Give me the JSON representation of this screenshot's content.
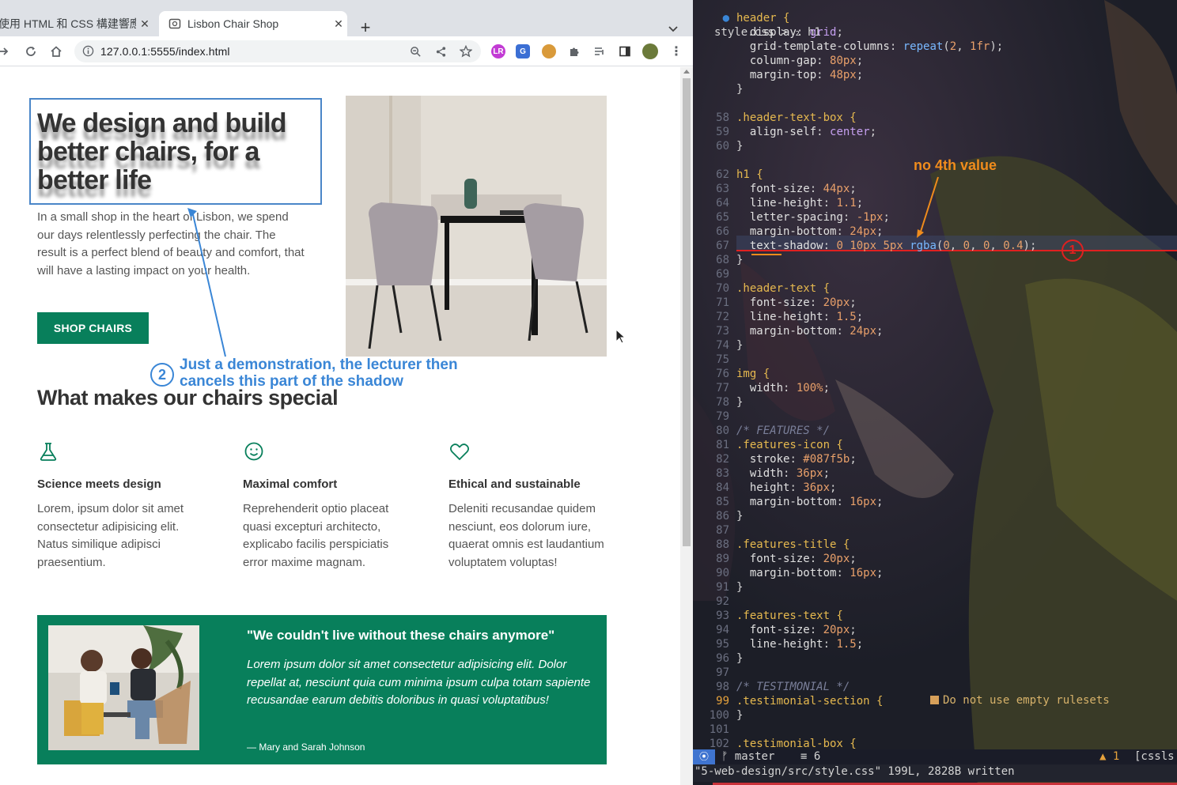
{
  "browser": {
    "tabs": [
      {
        "label": "使用 HTML 和 CSS 構建響應",
        "active": false
      },
      {
        "label": "Lisbon Chair Shop",
        "active": true
      }
    ],
    "url": "127.0.0.1:5555/index.html",
    "new_tab_glyph": "+",
    "close_glyph": "✕",
    "extensions": [
      "lr-icon",
      "translate-icon",
      "cookie-icon",
      "puzzle-icon",
      "playlist-icon",
      "sidepanel-icon",
      "profile-avatar"
    ]
  },
  "page": {
    "h1": "We design and build better chairs, for a better life",
    "header_text": "In a small shop in the heart of Lisbon, we spend our days relentlessly perfecting the chair. The result is a perfect blend of beauty and comfort, that will have a lasting impact on your health.",
    "cta": "SHOP CHAIRS",
    "features_heading": "What makes our chairs special",
    "features": [
      {
        "icon": "flask-icon",
        "title": "Science meets design",
        "text": "Lorem, ipsum dolor sit amet consectetur adipisicing elit. Natus similique adipisci praesentium."
      },
      {
        "icon": "smiley-icon",
        "title": "Maximal comfort",
        "text": "Reprehenderit optio placeat quasi excepturi architecto, explicabo facilis perspiciatis error maxime magnam."
      },
      {
        "icon": "heart-icon",
        "title": "Ethical and sustainable",
        "text": "Deleniti recusandae quidem nesciunt, eos dolorum iure, quaerat omnis est laudantium voluptatem voluptas!"
      }
    ],
    "testimonial": {
      "quote": "\"We couldn't live without these chairs anymore\"",
      "text": "Lorem ipsum dolor sit amet consectetur adipisicing elit. Dolor repellat at, nesciunt quia cum minima ipsum culpa totam sapiente recusandae earum debitis doloribus in quasi voluptatibus!",
      "author": "— Mary and Sarah Johnson"
    },
    "accent_color": "#087f5b"
  },
  "annotations": {
    "a1_num": "1",
    "a2_num": "2",
    "a2_text_line1": "Just a demonstration, the lecturer then",
    "a2_text_line2": "cancels this part of the shadow",
    "no4th": "no 4th value"
  },
  "editor": {
    "breadcrumb": "style.css > ₂ h1",
    "lines": [
      {
        "n": "",
        "code": "header {"
      },
      {
        "n": "",
        "code": "  display: grid;"
      },
      {
        "n": "",
        "code": "  grid-template-columns: repeat(2, 1fr);"
      },
      {
        "n": "",
        "code": "  column-gap: 80px;"
      },
      {
        "n": "",
        "code": "  margin-top: 48px;"
      },
      {
        "n": "",
        "code": "}"
      },
      {
        "n": "",
        "code": ""
      },
      {
        "n": "58",
        "code": ".header-text-box {"
      },
      {
        "n": "59",
        "code": "  align-self: center;"
      },
      {
        "n": "60",
        "code": "}"
      },
      {
        "n": "",
        "code": ""
      },
      {
        "n": "62",
        "code": "h1 {"
      },
      {
        "n": "63",
        "code": "  font-size: 44px;"
      },
      {
        "n": "64",
        "code": "  line-height: 1.1;"
      },
      {
        "n": "65",
        "code": "  letter-spacing: -1px;"
      },
      {
        "n": "66",
        "code": "  margin-bottom: 24px;"
      },
      {
        "n": "67",
        "code": "  text-shadow: 0 10px 5px rgba(0, 0, 0, 0.4);"
      },
      {
        "n": "68",
        "code": "}"
      },
      {
        "n": "69",
        "code": ""
      },
      {
        "n": "70",
        "code": ".header-text {"
      },
      {
        "n": "71",
        "code": "  font-size: 20px;"
      },
      {
        "n": "72",
        "code": "  line-height: 1.5;"
      },
      {
        "n": "73",
        "code": "  margin-bottom: 24px;"
      },
      {
        "n": "74",
        "code": "}"
      },
      {
        "n": "75",
        "code": ""
      },
      {
        "n": "76",
        "code": "img {"
      },
      {
        "n": "77",
        "code": "  width: 100%;"
      },
      {
        "n": "78",
        "code": "}"
      },
      {
        "n": "79",
        "code": ""
      },
      {
        "n": "80",
        "code": "/* FEATURES */"
      },
      {
        "n": "81",
        "code": ".features-icon {"
      },
      {
        "n": "82",
        "code": "  stroke: #087f5b;"
      },
      {
        "n": "83",
        "code": "  width: 36px;"
      },
      {
        "n": "84",
        "code": "  height: 36px;"
      },
      {
        "n": "85",
        "code": "  margin-bottom: 16px;"
      },
      {
        "n": "86",
        "code": "}"
      },
      {
        "n": "87",
        "code": ""
      },
      {
        "n": "88",
        "code": ".features-title {"
      },
      {
        "n": "89",
        "code": "  font-size: 20px;"
      },
      {
        "n": "90",
        "code": "  margin-bottom: 16px;"
      },
      {
        "n": "91",
        "code": "}"
      },
      {
        "n": "92",
        "code": ""
      },
      {
        "n": "93",
        "code": ".features-text {"
      },
      {
        "n": "94",
        "code": "  font-size: 20px;"
      },
      {
        "n": "95",
        "code": "  line-height: 1.5;"
      },
      {
        "n": "96",
        "code": "}"
      },
      {
        "n": "97",
        "code": ""
      },
      {
        "n": "98",
        "code": "/* TESTIMONIAL */"
      },
      {
        "n": "99",
        "code": ".testimonial-section {"
      },
      {
        "n": "100",
        "code": "}"
      },
      {
        "n": "101",
        "code": ""
      },
      {
        "n": "102",
        "code": ".testimonial-box {"
      }
    ],
    "lint_message": "Do not use empty rulesets",
    "status": {
      "branch": "master",
      "changes": "6",
      "warnings": "1",
      "filetype": "[cssls"
    },
    "cmdline": "\"5-web-design/src/style.css\" 199L, 2828B written"
  }
}
